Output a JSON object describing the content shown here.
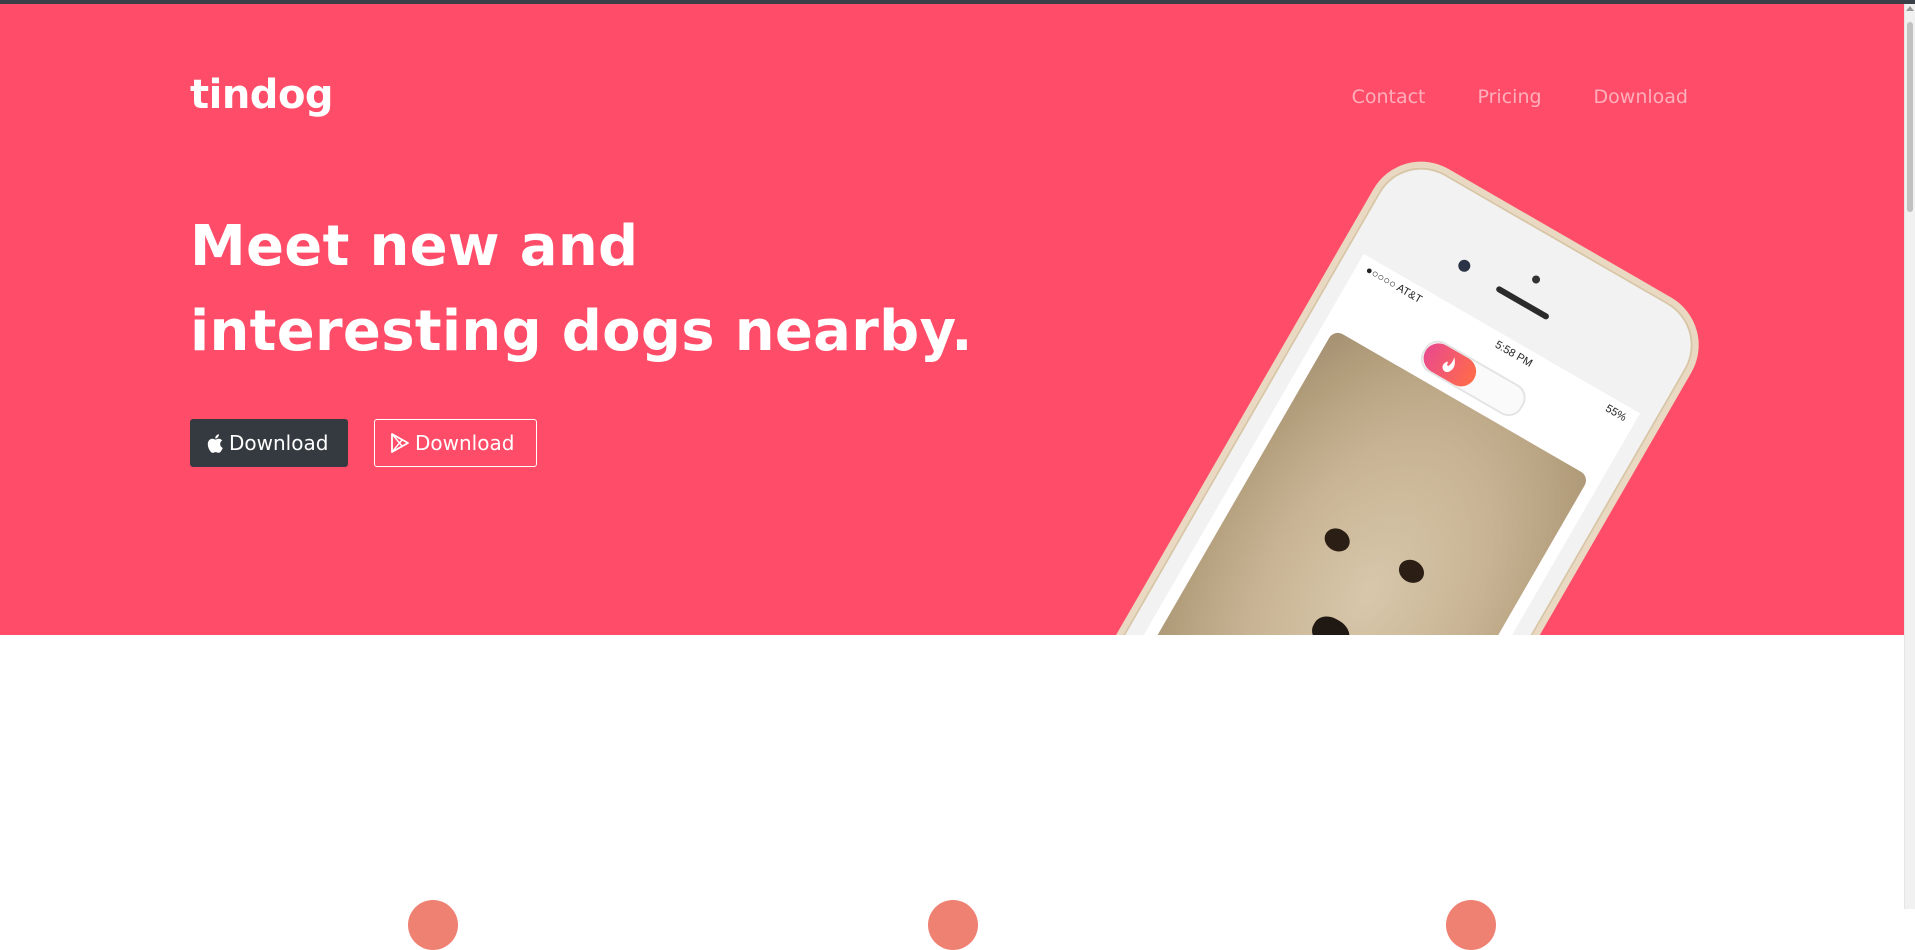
{
  "brand": "tindog",
  "nav": {
    "items": [
      "Contact",
      "Pricing",
      "Download"
    ]
  },
  "hero": {
    "headline_line1": "Meet new and",
    "headline_line2": "interesting dogs nearby.",
    "buttons": {
      "apple_label": "Download",
      "google_label": "Download"
    }
  },
  "phone": {
    "carrier": "●○○○○ AT&T",
    "time": "5:58 PM",
    "battery": "55%"
  },
  "colors": {
    "hero_bg": "#ff4c68",
    "dark_button": "#343a40",
    "feature_icon": "#ef8172"
  },
  "icons": {
    "apple": "apple-icon",
    "google_play": "google-play-icon"
  }
}
